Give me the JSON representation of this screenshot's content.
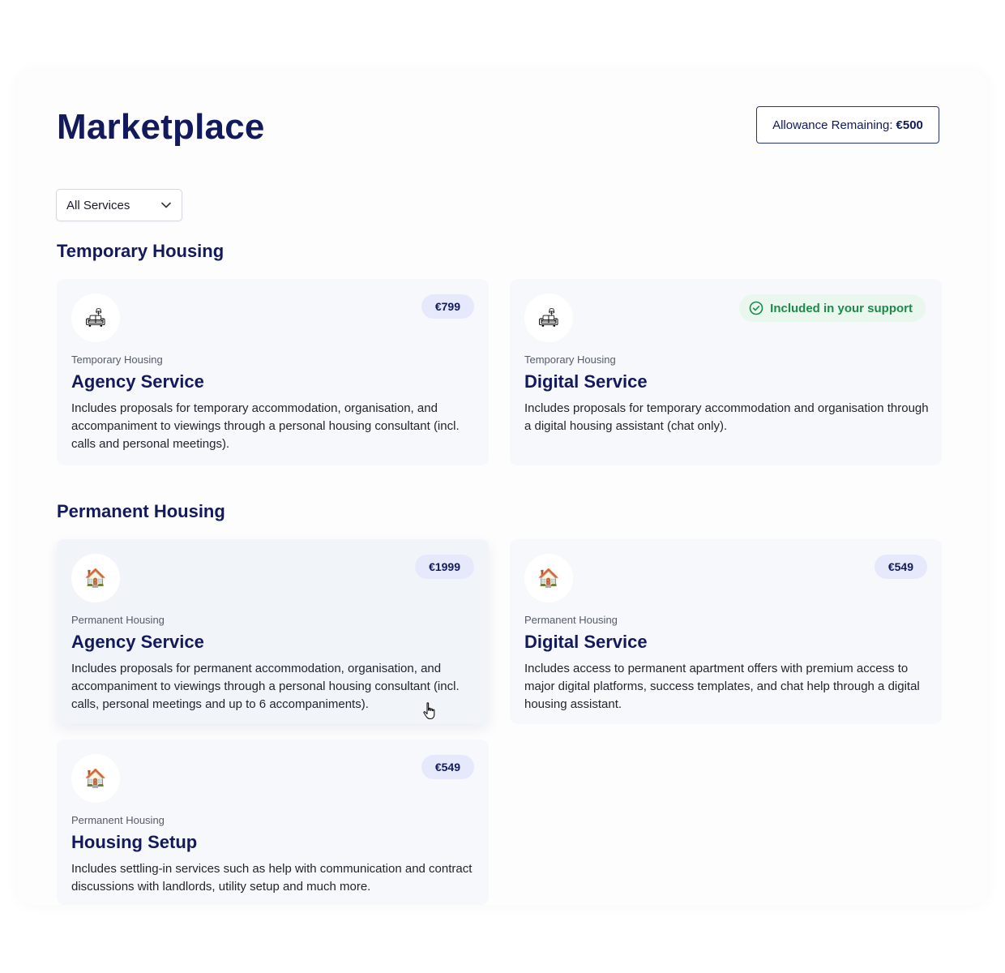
{
  "page": {
    "title": "Marketplace",
    "allowance_label": "Allowance Remaining:",
    "allowance_value": "€500"
  },
  "filter": {
    "selected": "All Services"
  },
  "sections": [
    {
      "title": "Temporary Housing",
      "cards": [
        {
          "icon": "sofa-icon",
          "icon_glyph": "🛋",
          "price": "€799",
          "category": "Temporary Housing",
          "name": "Agency Service",
          "description": "Includes proposals for temporary accommodation, organisation, and accompaniment to viewings through a personal housing consultant (incl. calls and personal meetings)."
        },
        {
          "icon": "sofa-icon",
          "icon_glyph": "🛋",
          "included_label": "Included in your support",
          "category": "Temporary Housing",
          "name": "Digital Service",
          "description": "Includes proposals for temporary accommodation and organisation through a digital housing assistant (chat only)."
        }
      ]
    },
    {
      "title": "Permanent Housing",
      "cards": [
        {
          "icon": "house-icon",
          "icon_glyph": "🏠",
          "price": "€1999",
          "category": "Permanent Housing",
          "name": "Agency Service",
          "description": "Includes proposals for permanent accommodation, organisation, and accompaniment to viewings through a personal housing consultant (incl. calls, personal meetings and up to 6 accompaniments)."
        },
        {
          "icon": "house-icon",
          "icon_glyph": "🏠",
          "price": "€549",
          "category": "Permanent Housing",
          "name": "Digital Service",
          "description": "Includes access to permanent apartment offers with premium access to major digital platforms, success templates, and chat help through a digital housing assistant."
        },
        {
          "icon": "house-icon",
          "icon_glyph": "🏠",
          "price": "€549",
          "category": "Permanent Housing",
          "name": "Housing Setup",
          "description": "Includes settling-in services such as help with communication and contract discussions with landlords, utility setup and much more."
        }
      ]
    }
  ],
  "colors": {
    "brand_navy": "#121a5c",
    "price_badge_bg": "#e6e9fb",
    "included_green": "#1d8a4a",
    "included_bg": "#eaf7ee",
    "card_bg": "#f7f8fb"
  }
}
